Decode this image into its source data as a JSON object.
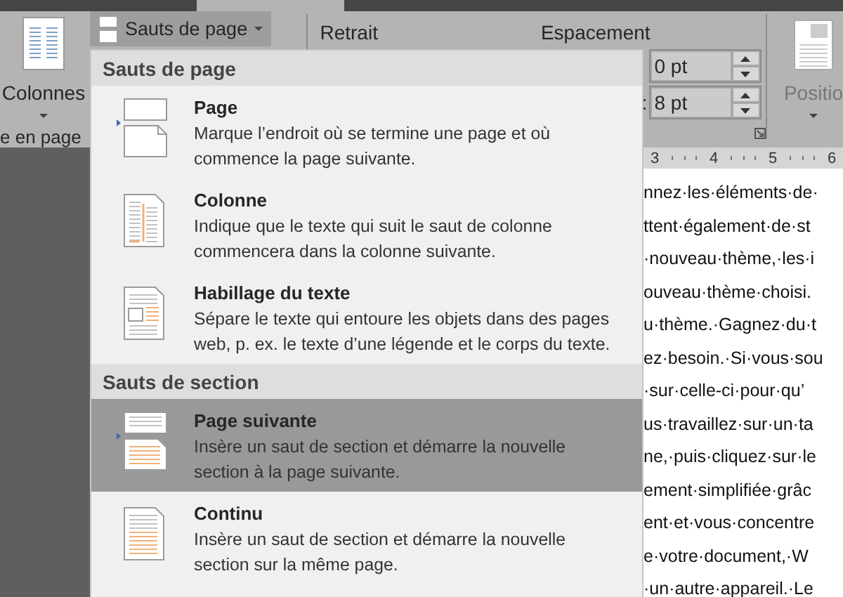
{
  "ribbon": {
    "columns_button": {
      "label": "Colonnes"
    },
    "group_label": "e en page",
    "page_breaks_button": {
      "label": "Sauts de page",
      "expanded": true
    },
    "indent_label": "Retrait",
    "spacing_label": "Espacement",
    "spacing_after_label": ":",
    "spacing_fields": [
      {
        "value": "0 pt"
      },
      {
        "value": "8 pt"
      }
    ],
    "position_button": {
      "label": "Positio"
    }
  },
  "ruler": {
    "marks": [
      "3",
      "4",
      "5",
      "6"
    ]
  },
  "document": {
    "paragraphs": [
      [
        "nnez·les·éléments·de·",
        "ttent·également·de·st",
        "·nouveau·thème,·les·i",
        "ouveau·thème·choisi.",
        "u·thème.·Gagnez·du·t",
        "ez·besoin.·Si·vous·sou",
        "·sur·celle-ci·pour·qu’",
        "us·travaillez·sur·un·ta",
        "ne,·puis·cliquez·sur·le"
      ],
      [
        "ement·simplifiée·grâc",
        "ent·et·vous·concentre",
        "e·votre·document,·W",
        "·un·autre·appareil.·Le"
      ]
    ]
  },
  "menu": {
    "sections": [
      {
        "title": "Sauts de page",
        "items": [
          {
            "kind": "page",
            "title": "Page",
            "description": "Marque l’endroit où se termine une page et où commence la page suivante.",
            "selected": false
          },
          {
            "kind": "column",
            "title": "Colonne",
            "description": "Indique que le texte qui suit le saut de colonne commencera dans la colonne suivante.",
            "selected": false
          },
          {
            "kind": "wrap",
            "title": "Habillage du texte",
            "description": "Sépare le texte qui entoure les objets dans des pages web, p. ex. le texte d’une légende et le corps du texte.",
            "selected": false
          }
        ]
      },
      {
        "title": "Sauts de section",
        "items": [
          {
            "kind": "next-page",
            "title": "Page suivante",
            "description": "Insère un saut de section et démarre la nouvelle section à la page suivante.",
            "selected": true
          },
          {
            "kind": "continuous",
            "title": "Continu",
            "description": "Insère un saut de section et démarre la nouvelle section sur la même page.",
            "selected": false
          }
        ]
      }
    ]
  }
}
